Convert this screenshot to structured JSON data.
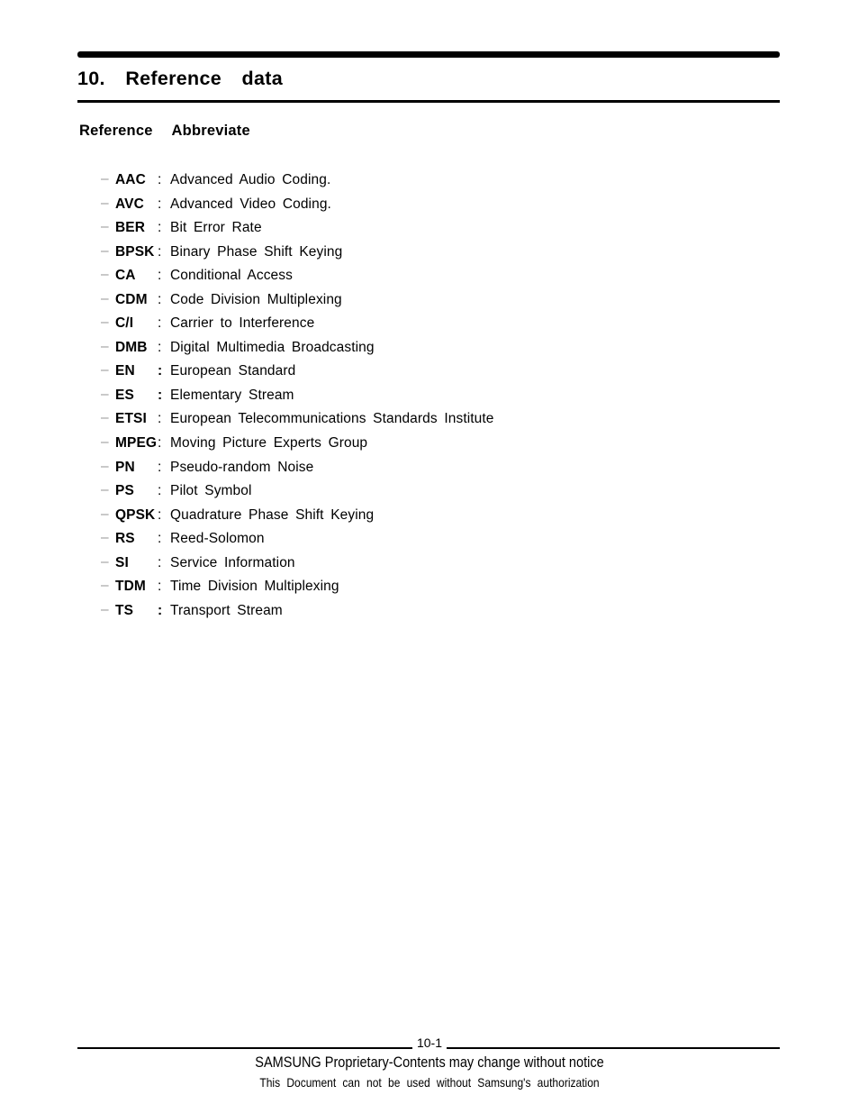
{
  "header": {
    "chapter_title": "10.  Reference  data",
    "section_heading": "Reference  Abbreviate"
  },
  "abbreviations": [
    {
      "term": "AAC",
      "separator": ":",
      "separator_bold": false,
      "definition": "Advanced  Audio  Coding."
    },
    {
      "term": "AVC",
      "separator": ":",
      "separator_bold": false,
      "definition": "Advanced  Video  Coding."
    },
    {
      "term": "BER",
      "separator": ":",
      "separator_bold": false,
      "definition": "Bit  Error  Rate"
    },
    {
      "term": "BPSK",
      "separator": ":",
      "separator_bold": false,
      "definition": "Binary  Phase  Shift  Keying"
    },
    {
      "term": "CA",
      "separator": ":",
      "separator_bold": false,
      "definition": "Conditional  Access"
    },
    {
      "term": "CDM",
      "separator": ":",
      "separator_bold": false,
      "definition": "Code  Division  Multiplexing"
    },
    {
      "term": "C/I",
      "separator": ":",
      "separator_bold": false,
      "definition": "Carrier  to  Interference"
    },
    {
      "term": "DMB",
      "separator": ":",
      "separator_bold": false,
      "definition": "Digital  Multimedia  Broadcasting"
    },
    {
      "term": "EN",
      "separator": ":",
      "separator_bold": true,
      "definition": "European  Standard"
    },
    {
      "term": "ES",
      "separator": ":",
      "separator_bold": true,
      "definition": "Elementary  Stream"
    },
    {
      "term": "ETSI",
      "separator": ":",
      "separator_bold": false,
      "definition": "European  Telecommunications  Standards  Institute"
    },
    {
      "term": "MPEG",
      "separator": ":",
      "separator_bold": false,
      "definition": "Moving  Picture  Experts  Group"
    },
    {
      "term": "PN",
      "separator": ":",
      "separator_bold": false,
      "definition": "Pseudo-random  Noise"
    },
    {
      "term": "PS",
      "separator": ":",
      "separator_bold": false,
      "definition": "Pilot  Symbol"
    },
    {
      "term": "QPSK",
      "separator": ":",
      "separator_bold": false,
      "definition": "Quadrature  Phase  Shift  Keying"
    },
    {
      "term": "RS",
      "separator": ":",
      "separator_bold": false,
      "definition": "Reed-Solomon"
    },
    {
      "term": "SI",
      "separator": ":",
      "separator_bold": false,
      "definition": "Service  Information"
    },
    {
      "term": "TDM",
      "separator": ":",
      "separator_bold": false,
      "definition": "Time  Division  Multiplexing"
    },
    {
      "term": "TS",
      "separator": ":",
      "separator_bold": true,
      "definition": "Transport  Stream"
    }
  ],
  "bullet_glyph": "–",
  "footer": {
    "page_number": "10-1",
    "line1": "SAMSUNG Proprietary-Contents may change without notice",
    "line2": "This Document can not be used without Samsung's authorization"
  },
  "colors": {
    "text": "#000000",
    "bullet": "#9a9a9a",
    "rule": "#000000",
    "background": "#ffffff"
  }
}
